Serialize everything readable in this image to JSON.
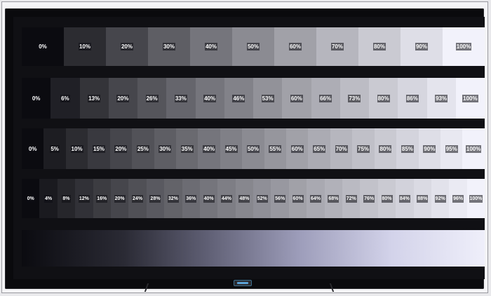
{
  "rows": [
    [
      "0%",
      "10%",
      "20%",
      "30%",
      "40%",
      "50%",
      "60%",
      "70%",
      "80%",
      "90%",
      "100%"
    ],
    [
      "0%",
      "6%",
      "13%",
      "20%",
      "26%",
      "33%",
      "40%",
      "46%",
      "53%",
      "60%",
      "66%",
      "73%",
      "80%",
      "86%",
      "93%",
      "100%"
    ],
    [
      "0%",
      "5%",
      "10%",
      "15%",
      "20%",
      "25%",
      "30%",
      "35%",
      "40%",
      "45%",
      "50%",
      "55%",
      "60%",
      "65%",
      "70%",
      "75%",
      "80%",
      "85%",
      "90%",
      "95%",
      "100%"
    ],
    [
      "0%",
      "4%",
      "8%",
      "12%",
      "16%",
      "20%",
      "24%",
      "28%",
      "32%",
      "36%",
      "40%",
      "44%",
      "48%",
      "52%",
      "56%",
      "60%",
      "64%",
      "68%",
      "72%",
      "76%",
      "80%",
      "84%",
      "88%",
      "92%",
      "96%",
      "100%"
    ]
  ],
  "gradient": {
    "start": "#0b0b10",
    "end": "#efeffa"
  },
  "patch_tint": "#f2f2fb"
}
